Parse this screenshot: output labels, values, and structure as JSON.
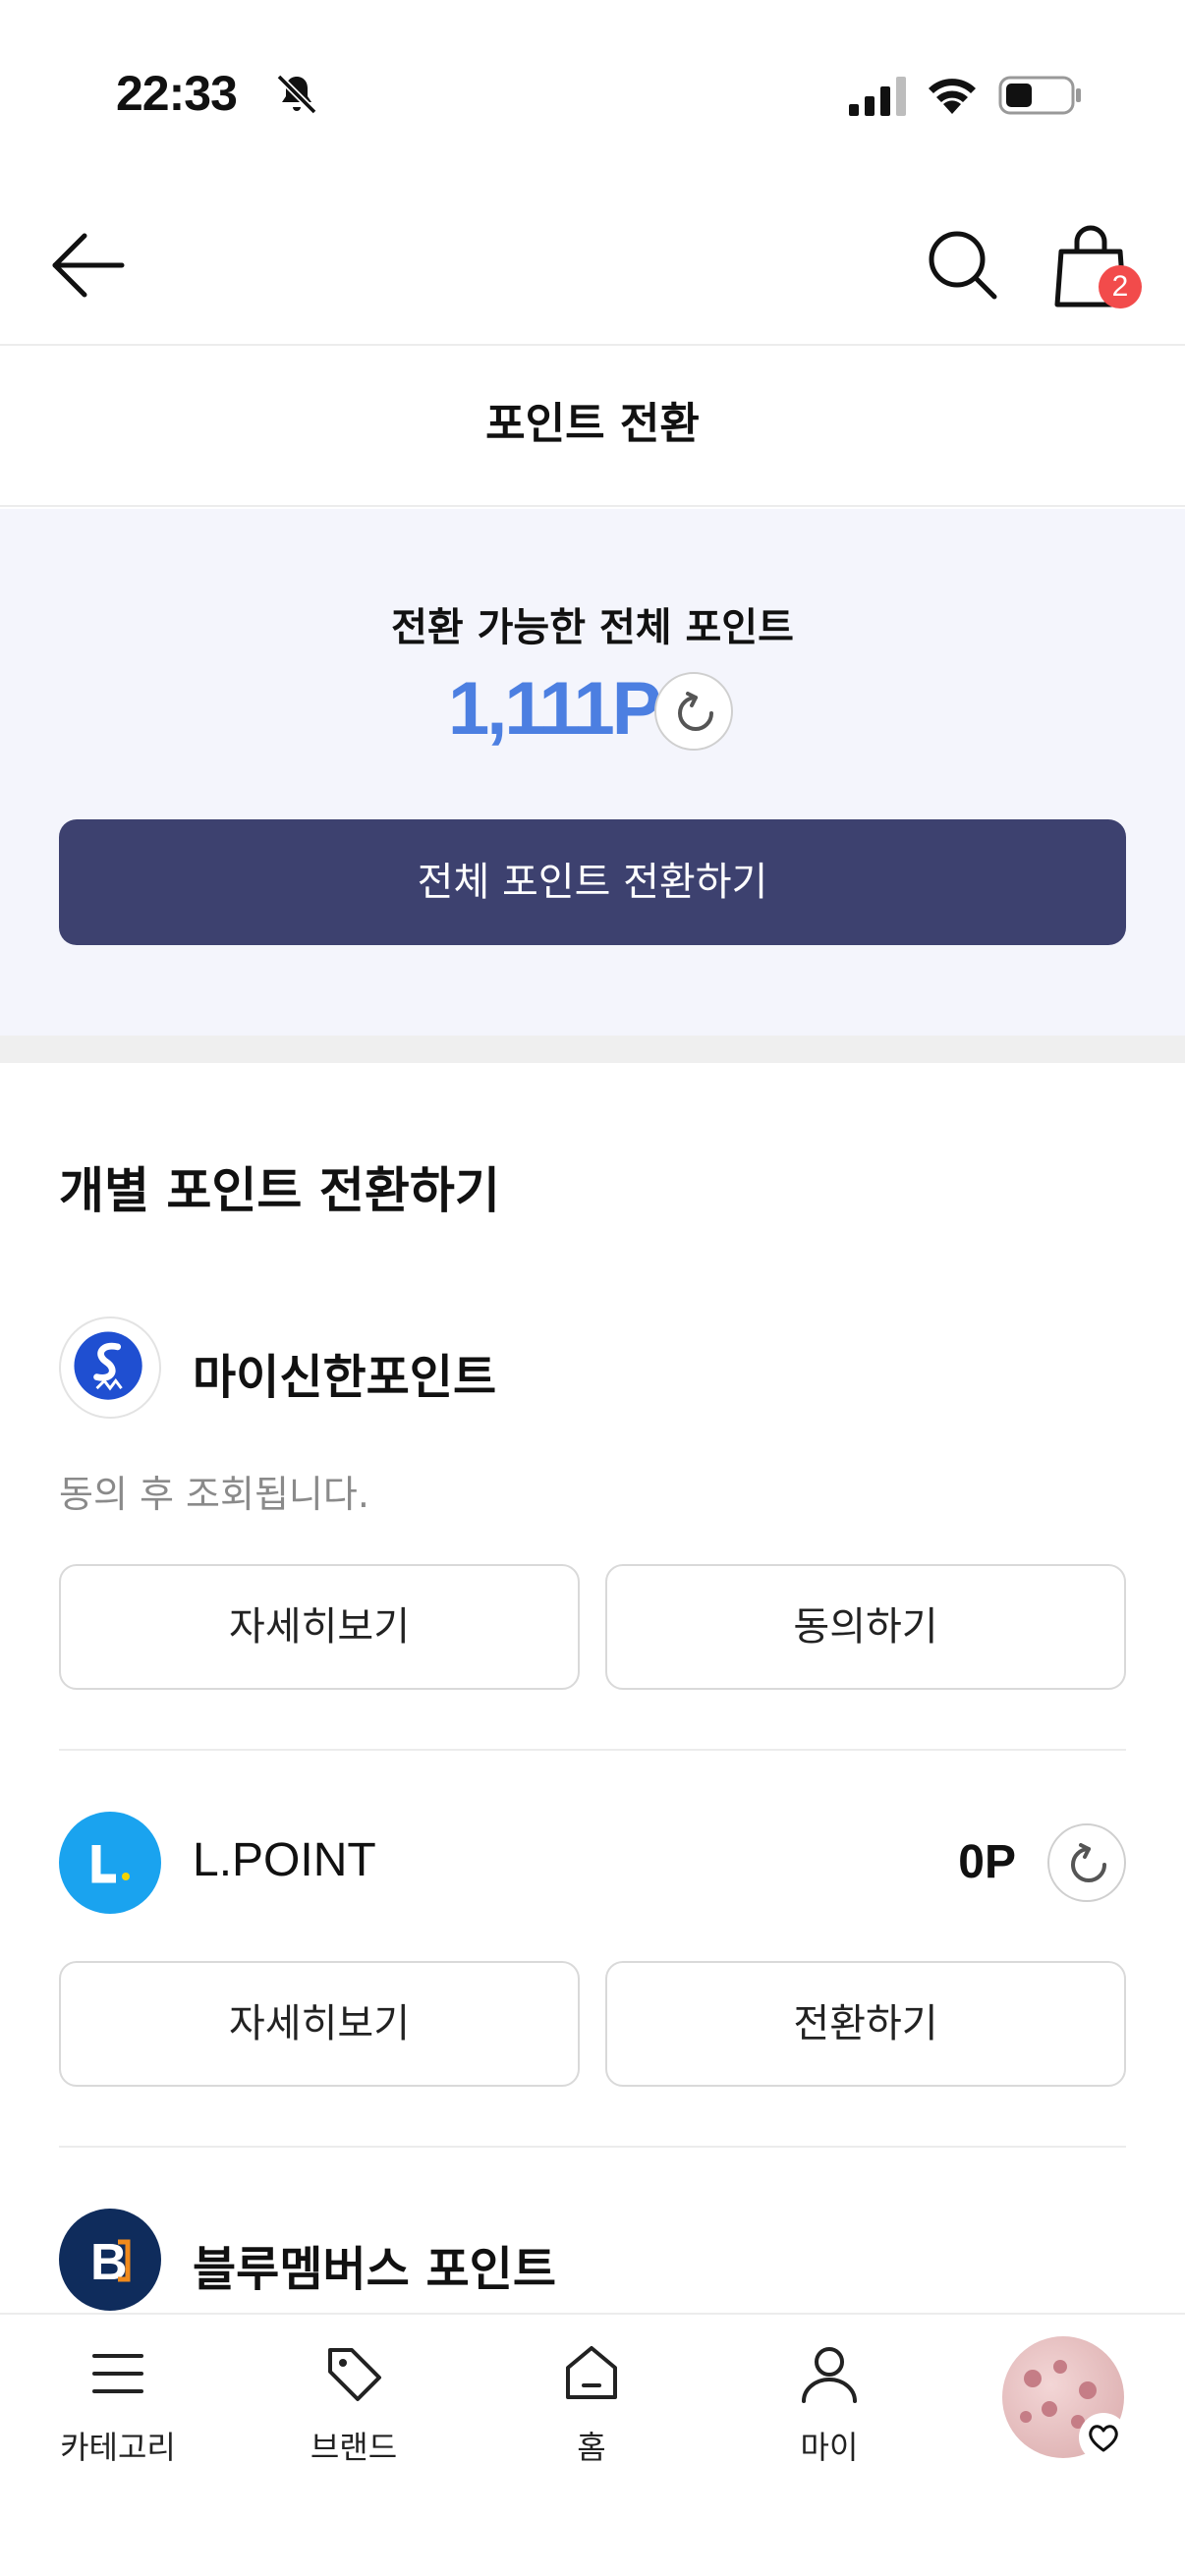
{
  "status_bar": {
    "time": "22:33"
  },
  "header": {
    "cart_count": "2"
  },
  "page_title": "포인트 전환",
  "summary": {
    "label": "전환 가능한 전체 포인트",
    "points": "1,111P",
    "convert_all_label": "전체 포인트 전환하기"
  },
  "individual_section": {
    "heading": "개별 포인트 전환하기"
  },
  "point_cards": [
    {
      "name": "마이신한포인트",
      "note": "동의 후 조회됩니다.",
      "detail_label": "자세히보기",
      "action_label": "동의하기"
    },
    {
      "name": "L.POINT",
      "value": "0P",
      "detail_label": "자세히보기",
      "action_label": "전환하기"
    },
    {
      "name": "블루멤버스 포인트"
    }
  ],
  "bottom_nav": {
    "items": [
      {
        "label": "카테고리",
        "icon": "menu-icon"
      },
      {
        "label": "브랜드",
        "icon": "tag-icon"
      },
      {
        "label": "홈",
        "icon": "home-icon"
      },
      {
        "label": "마이",
        "icon": "person-icon"
      }
    ]
  },
  "colors": {
    "accent_points": "#4c7fe1",
    "primary_button": "#3d416f",
    "summary_bg": "#f4f5fc",
    "badge": "#f24b4b",
    "shinhan_blue": "#1f4fd1",
    "lpoint_blue": "#1aa3ef",
    "bluemembers_navy": "#0f2c5c"
  }
}
